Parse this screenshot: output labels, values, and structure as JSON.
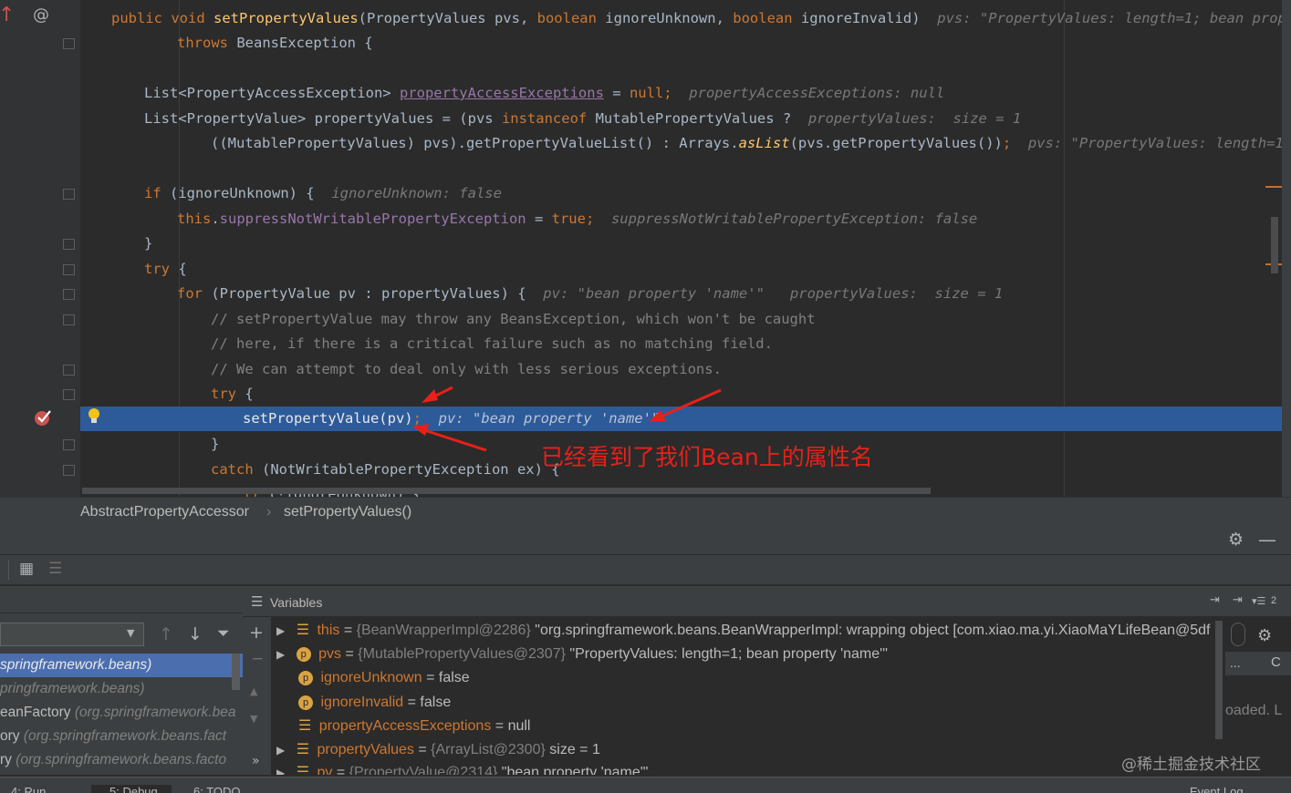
{
  "editor": {
    "l1": {
      "k1": "public",
      "k2": "void",
      "method": "setPropertyValues",
      "p1": "(PropertyValues pvs, ",
      "k3": "boolean",
      "p2": " ignoreUnknown, ",
      "k4": "boolean",
      "p3": " ignoreInvalid)",
      "hint": "pvs: \"PropertyValues: length=1; bean property"
    },
    "l2": {
      "k": "throws",
      "rest": " BeansException {"
    },
    "l3": {
      "a": "List<PropertyAccessException> ",
      "field": "propertyAccessExceptions",
      "b": " = ",
      "k": "null",
      "c": ";",
      "hint": "propertyAccessExceptions: null"
    },
    "l4": {
      "a": "List<PropertyValue> propertyValues = (pvs ",
      "k": "instanceof",
      "b": " MutablePropertyValues ?",
      "hint": "propertyValues:  size = 1"
    },
    "l5": {
      "a": "((MutablePropertyValues) pvs).getPropertyValueList() : Arrays.",
      "it": "asList",
      "b": "(pvs.getPropertyValues())",
      "k": ";",
      "hint": "pvs: \"PropertyValues: length=1; be"
    },
    "l6": {
      "k": "if",
      "rest": " (ignoreUnknown) {",
      "hint": "ignoreUnknown: false"
    },
    "l7": {
      "k": "this",
      "dot": ".",
      "field": "suppressNotWritablePropertyException",
      "b": " = ",
      "k2": "true",
      "c": ";",
      "hint": "suppressNotWritablePropertyException: false"
    },
    "l8": {
      "text": "}"
    },
    "l9": {
      "k": "try",
      "rest": " {"
    },
    "l10": {
      "k": "for",
      "rest": " (PropertyValue pv : propertyValues) {",
      "hint": "pv: \"bean property 'name'\"   propertyValues:  size = 1"
    },
    "l11": {
      "text": "// setPropertyValue may throw any BeansException, which won't be caught"
    },
    "l12": {
      "text": "// here, if there is a critical failure such as no matching field."
    },
    "l13": {
      "text": "// We can attempt to deal only with less serious exceptions."
    },
    "l14": {
      "k": "try",
      "rest": " {"
    },
    "l15": {
      "text": "setPropertyValue(pv)",
      "k": ";",
      "hint": "pv: \"bean property 'name'\""
    },
    "l16": {
      "text": "}"
    },
    "l17": {
      "k": "catch",
      "rest": " (NotWritablePropertyException ex) {"
    },
    "l18": {
      "k": "if",
      "rest": " (!ignoreUnknown) {"
    }
  },
  "annotation": "已经看到了我们Bean上的属性名",
  "breadcrumb": {
    "class_name": "AbstractPropertyAccessor",
    "method_name": "setPropertyValues()"
  },
  "frames": [
    {
      "a": "",
      "b": "springframework.beans)"
    },
    {
      "a": "",
      "b": "pringframework.beans)"
    },
    {
      "a": "eanFactory ",
      "b": "(org.springframework.bea"
    },
    {
      "a": "ory ",
      "b": "(org.springframework.beans.fact"
    },
    {
      "a": "ry ",
      "b": "(org.springframework.beans.facto"
    }
  ],
  "variables": {
    "title": "Variables",
    "rows": [
      {
        "name": "this",
        "eq": " = ",
        "ref": "{BeanWrapperImpl@2286}",
        "val": " \"org.springframework.beans.BeanWrapperImpl: wrapping object [com.xiao.ma.yi.XiaoMaYLifeBean@5df"
      },
      {
        "name": "pvs",
        "eq": " = ",
        "ref": "{MutablePropertyValues@2307}",
        "val": " \"PropertyValues: length=1; bean property 'name'\""
      },
      {
        "name": "ignoreUnknown",
        "eq": " = ",
        "ref": "",
        "val": "false"
      },
      {
        "name": "ignoreInvalid",
        "eq": " = ",
        "ref": "",
        "val": "false"
      },
      {
        "name": "propertyAccessExceptions",
        "eq": " = ",
        "ref": "",
        "val": "null"
      },
      {
        "name": "propertyValues",
        "eq": " = ",
        "ref": "{ArrayList@2300}",
        "val": "  size = 1"
      },
      {
        "name": "pv",
        "eq": " = ",
        "ref": "{PropertyValue@2314}",
        "val": " \"bean property 'name'\""
      }
    ],
    "side_loaded": "oaded. L",
    "side_c": "C",
    "side_dots": "...",
    "restore_count": "2"
  },
  "bottom_tabs": [
    "4: Run",
    "5: Debug",
    "6: TODO",
    "Event Log"
  ],
  "watermark": "@稀土掘金技术社区",
  "colors": {
    "keyword": "#cc7832",
    "method": "#ffc66d",
    "field": "#9876aa",
    "exec_line": "#2d5b9a",
    "annotation": "#e8201a"
  }
}
